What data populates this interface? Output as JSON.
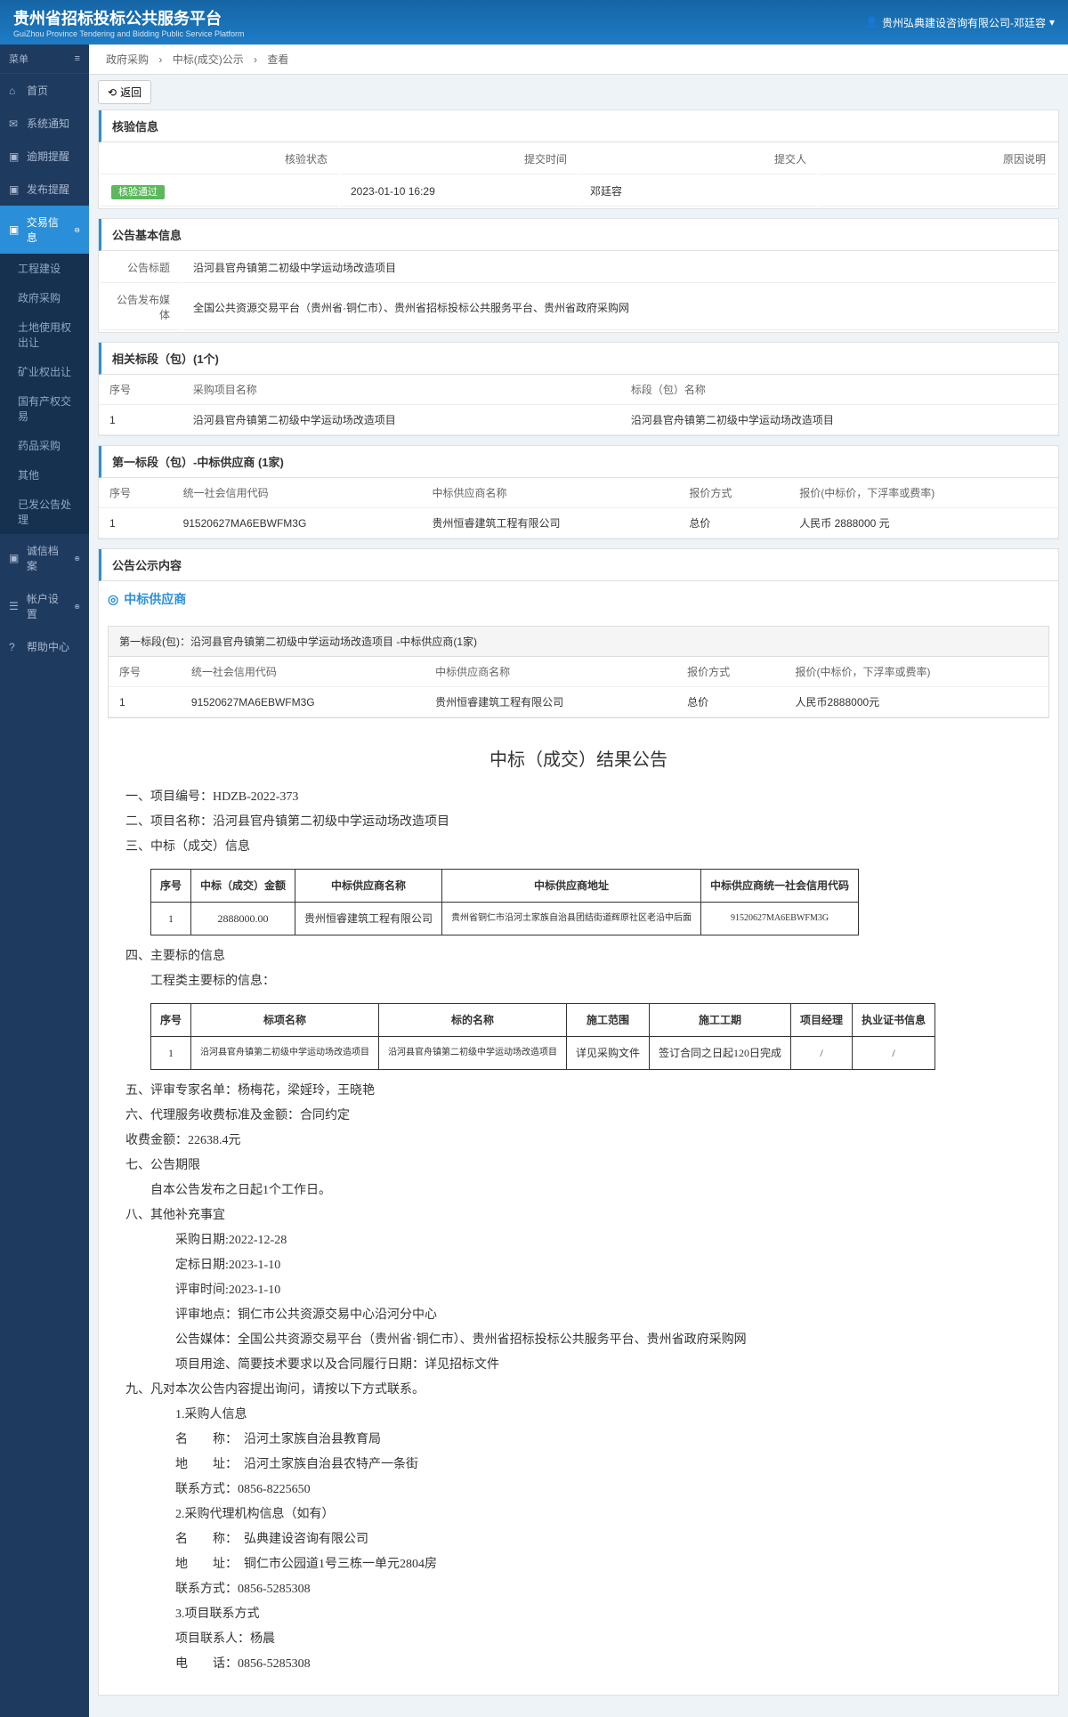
{
  "header": {
    "title": "贵州省招标投标公共服务平台",
    "subtitle": "GuiZhou Province Tendering and Bidding Public Service Platform",
    "user": "贵州弘典建设咨询有限公司-邓廷容"
  },
  "sidebar": {
    "menuLabel": "菜单",
    "items": [
      {
        "label": "首页",
        "icon": "⌂"
      },
      {
        "label": "系统通知",
        "icon": "✉"
      },
      {
        "label": "逾期提醒",
        "icon": "▣"
      },
      {
        "label": "发布提醒",
        "icon": "▣"
      },
      {
        "label": "交易信息",
        "icon": "▣",
        "active": true
      },
      {
        "label": "诚信档案",
        "icon": "▣"
      },
      {
        "label": "帐户设置",
        "icon": "☰"
      },
      {
        "label": "帮助中心",
        "icon": "?"
      }
    ],
    "submenu": [
      "工程建设",
      "政府采购",
      "土地使用权出让",
      "矿业权出让",
      "国有产权交易",
      "药品采购",
      "其他",
      "已发公告处理"
    ]
  },
  "breadcrumb": [
    "政府采购",
    "中标(成交)公示",
    "查看"
  ],
  "backBtn": "返回",
  "verify": {
    "title": "核验信息",
    "statusLabel": "核验状态",
    "statusValue": "核验通过",
    "timeLabel": "提交时间",
    "timeValue": "2023-01-10 16:29",
    "submitterLabel": "提交人",
    "submitterValue": "邓廷容",
    "reasonLabel": "原因说明"
  },
  "basic": {
    "title": "公告基本信息",
    "titleLabel": "公告标题",
    "titleValue": "沿河县官舟镇第二初级中学运动场改造项目",
    "mediaLabel": "公告发布媒体",
    "mediaValue": "全国公共资源交易平台（贵州省·铜仁市）、贵州省招标投标公共服务平台、贵州省政府采购网"
  },
  "sections": {
    "title": "相关标段（包）(1个)",
    "cols": [
      "序号",
      "采购项目名称",
      "标段（包）名称"
    ],
    "row": [
      "1",
      "沿河县官舟镇第二初级中学运动场改造项目",
      "沿河县官舟镇第二初级中学运动场改造项目"
    ]
  },
  "winning": {
    "title": "第一标段（包）-中标供应商 (1家)",
    "cols": [
      "序号",
      "统一社会信用代码",
      "中标供应商名称",
      "报价方式",
      "报价(中标价，下浮率或费率)"
    ],
    "row": [
      "1",
      "91520627MA6EBWFM3G",
      "贵州恒睿建筑工程有限公司",
      "总价",
      "人民币 2888000 元"
    ]
  },
  "notice": {
    "title": "公告公示内容",
    "supplierHeader": "中标供应商",
    "supplierTitle": "第一标段(包)：沿河县官舟镇第二初级中学运动场改造项目 -中标供应商(1家)",
    "cols": [
      "序号",
      "统一社会信用代码",
      "中标供应商名称",
      "报价方式",
      "报价(中标价，下浮率或费率)"
    ],
    "row": [
      "1",
      "91520627MA6EBWFM3G",
      "贵州恒睿建筑工程有限公司",
      "总价",
      "人民币2888000元"
    ]
  },
  "announcement": {
    "title": "中标（成交）结果公告",
    "line1": "一、项目编号：HDZB-2022-373",
    "line2": "二、项目名称：沿河县官舟镇第二初级中学运动场改造项目",
    "line3": "三、中标（成交）信息",
    "t1cols": [
      "序号",
      "中标（成交）金额",
      "中标供应商名称",
      "中标供应商地址",
      "中标供应商统一社会信用代码"
    ],
    "t1row": [
      "1",
      "2888000.00",
      "贵州恒睿建筑工程有限公司",
      "贵州省铜仁市沿河土家族自治县团结街道辉原社区老沿中后面",
      "91520627MA6EBWFM3G"
    ],
    "line4": "四、主要标的信息",
    "line4sub": "工程类主要标的信息：",
    "t2cols": [
      "序号",
      "标项名称",
      "标的名称",
      "施工范围",
      "施工工期",
      "项目经理",
      "执业证书信息"
    ],
    "t2row": [
      "1",
      "沿河县官舟镇第二初级中学运动场改造项目",
      "沿河县官舟镇第二初级中学运动场改造项目",
      "详见采购文件",
      "签订合同之日起120日完成",
      "/",
      "/"
    ],
    "line5": "五、评审专家名单：杨梅花，梁婬玲，王晓艳",
    "line6": "六、代理服务收费标准及金额：合同约定",
    "fee": "收费金额：22638.4元",
    "line7": "七、公告期限",
    "period": "自本公告发布之日起1个工作日。",
    "line8": "八、其他补充事宜",
    "purchaseDate": "采购日期:2022-12-28",
    "awardDate": "定标日期:2023-1-10",
    "reviewTime": "评审时间:2023-1-10",
    "reviewPlace": "评审地点：铜仁市公共资源交易中心沿河分中心",
    "media": "公告媒体：全国公共资源交易平台（贵州省·铜仁市）、贵州省招标投标公共服务平台、贵州省政府采购网",
    "purpose": "项目用途、简要技术要求以及合同履行日期：详见招标文件",
    "line9": "九、凡对本次公告内容提出询问，请按以下方式联系。",
    "c1title": "1.采购人信息",
    "c1name": "名　　称：　沿河土家族自治县教育局",
    "c1addr": "地　　址：　沿河土家族自治县农特产一条街",
    "c1tel": "联系方式：0856-8225650",
    "c2title": "2.采购代理机构信息（如有）",
    "c2name": "名　　称：　弘典建设咨询有限公司",
    "c2addr": "地　　址：　铜仁市公园道1号三栋一单元2804房",
    "c2tel": "联系方式：0856-5285308",
    "c3title": "3.项目联系方式",
    "c3name": "项目联系人：杨晨",
    "c3tel": "电　　话：0856-5285308"
  }
}
